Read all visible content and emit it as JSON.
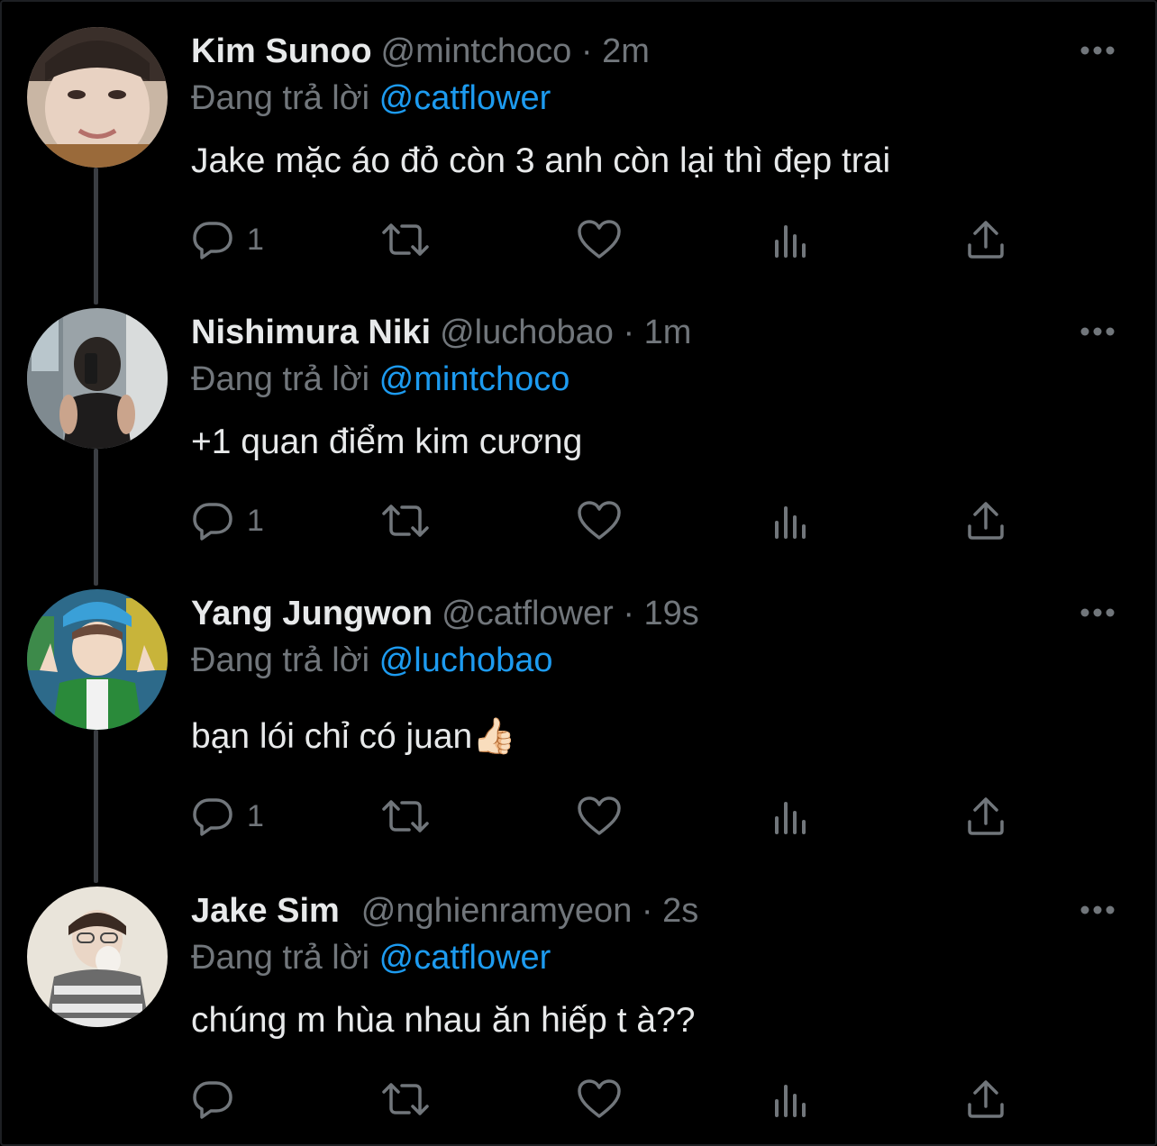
{
  "colors": {
    "background": "#000000",
    "primary_text": "#e7e9ea",
    "secondary_text": "#71767b",
    "mention": "#1d9bf0",
    "thread_line": "#3a3d42"
  },
  "tweets": [
    {
      "name": "Kim Sunoo",
      "handle": "@mintchoco",
      "time": "2m",
      "meta": "@mintchoco · 2m",
      "reply_prefix": "Đang trả lời",
      "reply_to": "@catflower",
      "text": "Jake mặc áo đỏ còn 3 anh còn lại thì đẹp trai",
      "reply_count": "1",
      "avatar": "photo-portrait-smiling"
    },
    {
      "name": "Nishimura Niki",
      "handle": "@luchobao",
      "time": "1m",
      "meta": "@luchobao · 1m",
      "reply_prefix": "Đang trả lời",
      "reply_to": "@mintchoco",
      "text": "+1 quan điểm kim cương",
      "reply_count": "1",
      "avatar": "photo-mirror-selfie"
    },
    {
      "name": "Yang Jungwon",
      "handle": "@catflower",
      "time": "19s",
      "meta": "@catflower · 19s",
      "reply_prefix": "Đang trả lời",
      "reply_to": "@luchobao",
      "text": "bạn lói chỉ có juan👍🏻",
      "reply_count": "1",
      "avatar": "photo-peace-sign"
    },
    {
      "name": "Jake Sim",
      "handle": "@nghienramyeon",
      "time": "2s",
      "meta": "@nghienramyeon · 2s",
      "reply_prefix": "Đang trả lời",
      "reply_to": "@catflower",
      "text": "chúng m hùa nhau ăn hiếp t à??",
      "reply_count": "",
      "avatar": "photo-striped-sweater"
    }
  ],
  "icons": {
    "more": "more-horizontal-icon",
    "reply": "reply-bubble-icon",
    "retweet": "retweet-icon",
    "like": "heart-icon",
    "views": "views-bar-chart-icon",
    "share": "share-upload-icon"
  }
}
